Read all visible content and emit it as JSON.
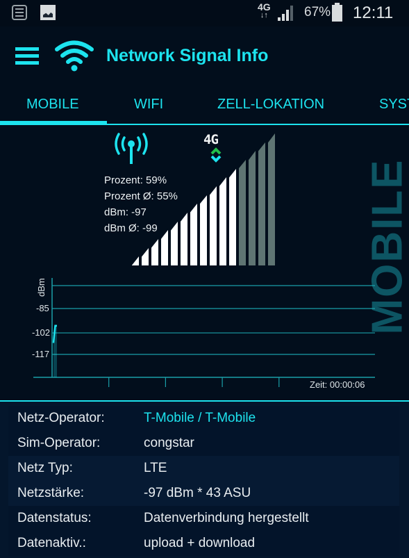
{
  "status_bar": {
    "left_icons": [
      "checklist-notification-icon",
      "image-notification-icon"
    ],
    "network_type": "4G",
    "network_arrows": "↓↑",
    "signal_icon": "cell-signal-icon",
    "battery_percent": "67%",
    "battery_icon": "battery-icon",
    "time": "12:11"
  },
  "app_bar": {
    "menu_icon": "hamburger-menu-icon",
    "logo_icon": "wifi-icon",
    "title": "Network Signal Info"
  },
  "tabs": {
    "items": [
      {
        "label": "MOBILE",
        "active": true
      },
      {
        "label": "WIFI",
        "active": false
      },
      {
        "label": "ZELL-LOKATION",
        "active": false
      },
      {
        "label": "SYSTEM",
        "active": false
      }
    ],
    "visible_partial_label": "SYST"
  },
  "signal_panel": {
    "antenna_icon": "cell-tower-icon",
    "network_badge": "4G",
    "network_badge_icon": "4g-data-activity-icon",
    "stats": [
      {
        "label": "Prozent",
        "value": "59%",
        "text": "Prozent: 59%"
      },
      {
        "label": "Prozent Ø",
        "value": "55%",
        "text": "Prozent Ø: 55%"
      },
      {
        "label": "dBm",
        "value": "-97",
        "text": "dBm: -97"
      },
      {
        "label": "dBm Ø",
        "value": "-99",
        "text": "dBm Ø: -99"
      }
    ],
    "signal_bars": {
      "total": 15,
      "active": 11
    },
    "colors": {
      "active_bar": "#ffffff",
      "inactive_bar": "#5f7573",
      "accent": "#1de3ee",
      "upload_arrow": "#22c04a"
    },
    "watermark": "MOBILE"
  },
  "chart_data": {
    "type": "line",
    "title": "",
    "ylabel": "dBm",
    "xlabel": "Zeit: 00:00:06",
    "y_ticks": [
      -85,
      -102,
      -117
    ],
    "y_tick_labels": [
      "-85",
      "-102",
      "-117"
    ],
    "ylim": [
      -130,
      -70
    ],
    "x_range_seconds": [
      0,
      60
    ],
    "x_tick_count": 5,
    "grid": true,
    "series": [
      {
        "name": "dBm",
        "x": [
          0,
          1,
          2
        ],
        "values": [
          -109,
          -97,
          -97
        ],
        "color": "#1de3ee"
      }
    ]
  },
  "info": {
    "rows": [
      {
        "label": "Netz-Operator:",
        "value": "T-Mobile / T-Mobile",
        "accent": true
      },
      {
        "label": "Sim-Operator:",
        "value": "congstar",
        "accent": false
      },
      {
        "label": "Netz Typ:",
        "value": "LTE",
        "accent": false
      },
      {
        "label": "Netzstärke:",
        "value": "-97 dBm * 43 ASU",
        "accent": false
      },
      {
        "label": "Datenstatus:",
        "value": "Datenverbindung hergestellt",
        "accent": false
      },
      {
        "label": "Datenaktiv.:",
        "value": "upload + download",
        "accent": false
      }
    ]
  }
}
